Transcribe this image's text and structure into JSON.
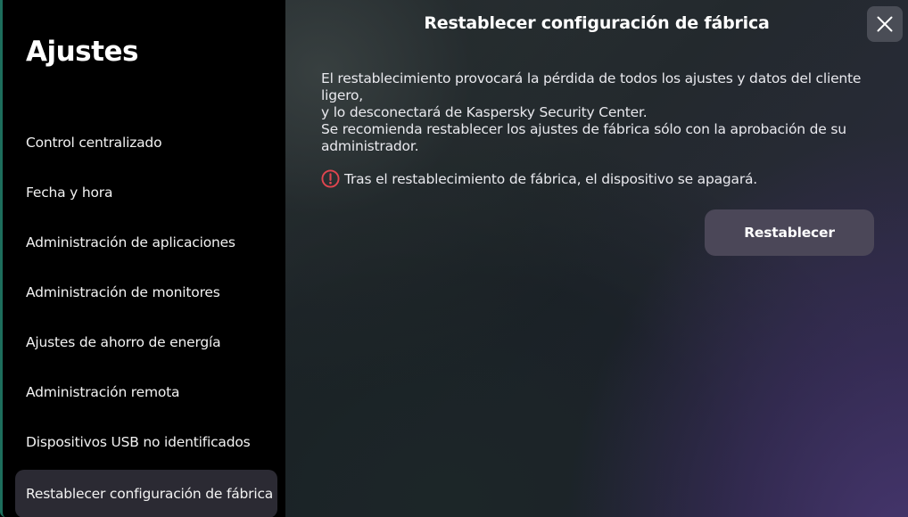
{
  "sidebar": {
    "title": "Ajustes",
    "items": [
      {
        "label": "Control centralizado"
      },
      {
        "label": "Fecha y hora"
      },
      {
        "label": "Administración de aplicaciones"
      },
      {
        "label": "Administración de monitores"
      },
      {
        "label": "Ajustes de ahorro de energía"
      },
      {
        "label": "Administración remota"
      },
      {
        "label": "Dispositivos USB no identificados"
      },
      {
        "label": "Restablecer configuración de fábrica",
        "active": true
      }
    ]
  },
  "main": {
    "title": "Restablecer configuración de fábrica",
    "paragraph_1_line_1": "El restablecimiento provocará la pérdida de todos los ajustes y datos del cliente ligero,",
    "paragraph_1_line_2": "y lo desconectará de Kaspersky Security Center.",
    "paragraph_2_line_1": "Se recomienda restablecer los ajustes de fábrica sólo con la aprobación de su",
    "paragraph_2_line_2": "administrador.",
    "warning": "Tras el restablecimiento de fábrica, el dispositivo se apagará.",
    "reset_button_label": "Restablecer"
  },
  "icons": {
    "close": "close-icon",
    "warning": "warning-circle-icon"
  },
  "colors": {
    "sidebar_accent": "#1d6e5c",
    "active_item_bg": "#2b2a33",
    "warning_red": "#e0454f",
    "button_bg": "#4b4758"
  }
}
